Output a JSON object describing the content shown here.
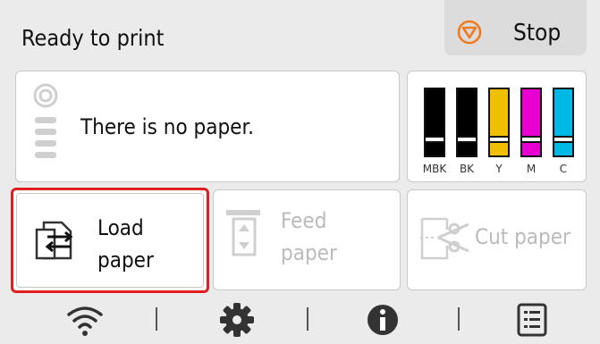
{
  "status": {
    "title": "Ready to print"
  },
  "stop": {
    "label": "Stop",
    "icon": "stop-icon",
    "color": "#f07b1f"
  },
  "paper": {
    "message": "There is no paper.",
    "icon": "paper-roll-icon"
  },
  "ink": {
    "tanks": [
      {
        "label": "MBK",
        "color": "#000000"
      },
      {
        "label": "BK",
        "color": "#000000"
      },
      {
        "label": "Y",
        "color": "#f0c000"
      },
      {
        "label": "M",
        "color": "#e800d0"
      },
      {
        "label": "C",
        "color": "#00b8e6"
      }
    ]
  },
  "actions": {
    "load": {
      "line1": "Load",
      "line2": "paper",
      "icon": "load-paper-icon"
    },
    "feed": {
      "line1": "Feed",
      "line2": "paper",
      "icon": "feed-paper-icon"
    },
    "cut": {
      "label": "Cut paper",
      "icon": "cut-paper-icon"
    }
  },
  "nav": {
    "items": [
      "wifi-icon",
      "settings-gear-icon",
      "info-icon",
      "job-list-icon"
    ]
  },
  "colors": {
    "highlight": "#e02020",
    "disabled_text": "#bbbbbb"
  }
}
